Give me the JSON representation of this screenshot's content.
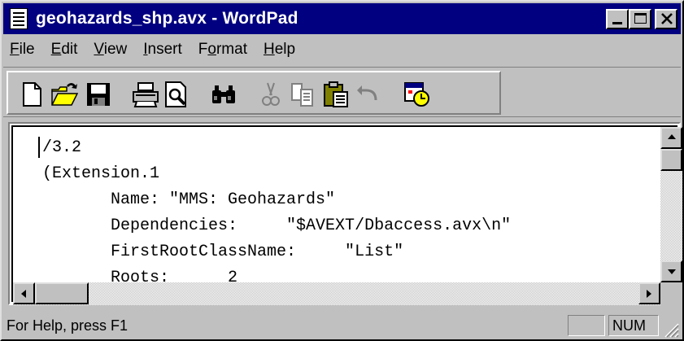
{
  "window": {
    "title": "geohazards_shp.avx - WordPad",
    "icon": "wordpad-document-icon"
  },
  "menu": [
    {
      "key": "F",
      "rest": "ile"
    },
    {
      "key": "E",
      "rest": "dit"
    },
    {
      "key": "V",
      "rest": "iew"
    },
    {
      "key": "I",
      "rest": "nsert"
    },
    {
      "pre": "F",
      "key": "o",
      "rest": "rmat"
    },
    {
      "key": "H",
      "rest": "elp"
    }
  ],
  "toolbar": {
    "buttons": [
      "new-icon",
      "open-icon",
      "save-icon",
      "print-icon",
      "print-preview-icon",
      "find-icon",
      "cut-icon",
      "copy-icon",
      "paste-icon",
      "undo-icon",
      "date-time-icon"
    ]
  },
  "document": {
    "lines": [
      "/3.2",
      "(Extension.1",
      "       Name: \"MMS: Geohazards\"",
      "       Dependencies:     \"$AVEXT/Dbaccess.avx\\n\"",
      "       FirstRootClassName:     \"List\"",
      "       Roots:      2"
    ]
  },
  "status": {
    "help_text": "For Help, press F1",
    "caps_indicator": "",
    "num_indicator": "NUM"
  }
}
